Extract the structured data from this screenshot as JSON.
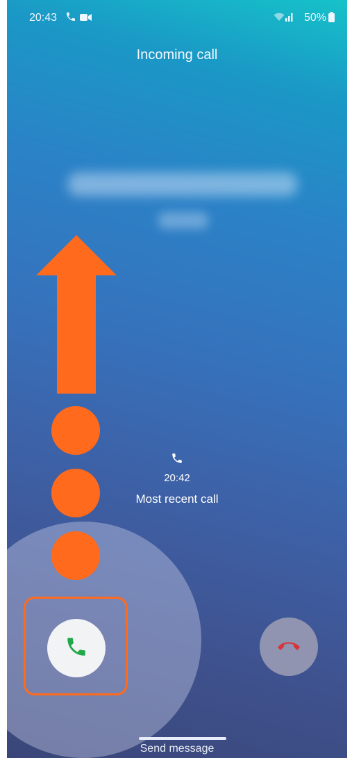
{
  "status_bar": {
    "time": "20:43",
    "battery": "50%",
    "icons": [
      "phone-call-icon",
      "video-icon",
      "wifi-icon",
      "signal-icon",
      "battery-icon"
    ]
  },
  "call": {
    "title": "Incoming call"
  },
  "recent_call": {
    "time": "20:42",
    "label": "Most recent call",
    "icon": "phone-icon"
  },
  "controls": {
    "accept_icon": "phone-accept-icon",
    "decline_icon": "phone-decline-icon",
    "send_message": "Send message"
  },
  "overlay": {
    "annotation": "swipe-up-arrow",
    "color": "#ff6a1d"
  },
  "colors": {
    "accept_green": "#22a84a",
    "decline_red": "#d8343a"
  }
}
